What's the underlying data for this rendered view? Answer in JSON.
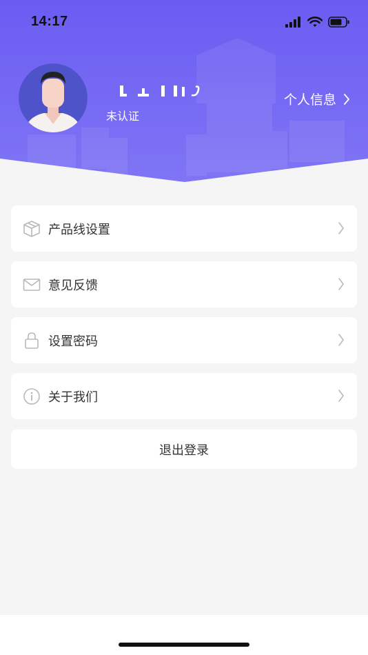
{
  "status_bar": {
    "time": "14:17"
  },
  "profile": {
    "auth_status": "未认证",
    "info_link": "个人信息"
  },
  "menu": {
    "items": [
      {
        "label": "产品线设置",
        "icon": "box-icon"
      },
      {
        "label": "意见反馈",
        "icon": "mail-icon"
      },
      {
        "label": "设置密码",
        "icon": "lock-icon"
      },
      {
        "label": "关于我们",
        "icon": "info-icon"
      }
    ]
  },
  "logout": {
    "label": "退出登录"
  },
  "colors": {
    "header_top": "#6a5cf2",
    "header_bottom": "#7d72f4",
    "background": "#f5f5f5",
    "card": "#ffffff",
    "text": "#333333",
    "icon_gray": "#b8b8b8"
  }
}
